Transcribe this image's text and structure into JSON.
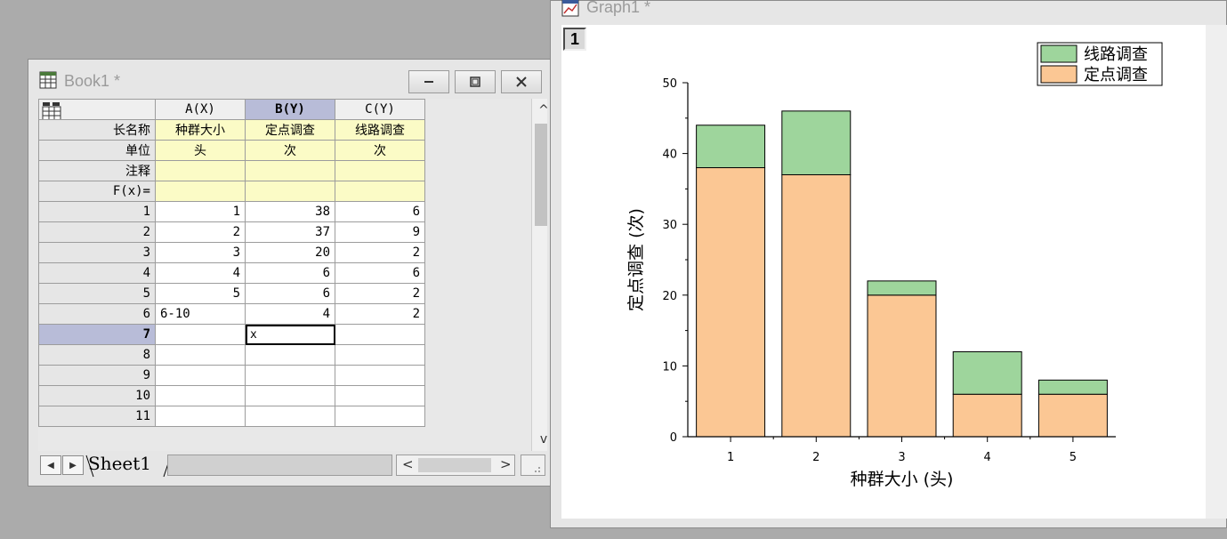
{
  "book": {
    "title": "Book1 *",
    "columns": [
      {
        "header": "A(X)",
        "long_name": "种群大小",
        "units": "头",
        "comments": "",
        "fx": ""
      },
      {
        "header": "B(Y)",
        "long_name": "定点调查",
        "units": "次",
        "comments": "",
        "fx": ""
      },
      {
        "header": "C(Y)",
        "long_name": "线路调查",
        "units": "次",
        "comments": "",
        "fx": ""
      }
    ],
    "row_labels": {
      "long_name": "长名称",
      "units": "单位",
      "comments": "注释",
      "fx": "F(x)="
    },
    "rows": [
      {
        "n": "1",
        "a": "1",
        "b": "38",
        "c": "6"
      },
      {
        "n": "2",
        "a": "2",
        "b": "37",
        "c": "9"
      },
      {
        "n": "3",
        "a": "3",
        "b": "20",
        "c": "2"
      },
      {
        "n": "4",
        "a": "4",
        "b": "6",
        "c": "6"
      },
      {
        "n": "5",
        "a": "5",
        "b": "6",
        "c": "2"
      },
      {
        "n": "6",
        "a": "6-10",
        "b": "4",
        "c": "2"
      },
      {
        "n": "7",
        "a": "",
        "b": "x",
        "c": ""
      },
      {
        "n": "8",
        "a": "",
        "b": "",
        "c": ""
      },
      {
        "n": "9",
        "a": "",
        "b": "",
        "c": ""
      },
      {
        "n": "10",
        "a": "",
        "b": "",
        "c": ""
      },
      {
        "n": "11",
        "a": "",
        "b": "",
        "c": ""
      }
    ],
    "sheet_tab": "Sheet1",
    "scroll_up": "^",
    "scroll_down": "v",
    "scroll_left": "<",
    "scroll_right": ">"
  },
  "graph": {
    "title": "Graph1 *",
    "layer": "1"
  },
  "chart_data": {
    "type": "bar",
    "stacked": true,
    "categories": [
      "1",
      "2",
      "3",
      "4",
      "5"
    ],
    "series": [
      {
        "name": "定点调查",
        "values": [
          38,
          37,
          20,
          6,
          6
        ],
        "color": "#fbc794"
      },
      {
        "name": "线路调查",
        "values": [
          6,
          9,
          2,
          6,
          2
        ],
        "color": "#9ed59c"
      }
    ],
    "xlabel": "种群大小 (头)",
    "ylabel": "定点调查 (次)",
    "ylim": [
      0,
      50
    ],
    "yticks": [
      0,
      10,
      20,
      30,
      40,
      50
    ],
    "grid": false,
    "legend": "top-right"
  }
}
